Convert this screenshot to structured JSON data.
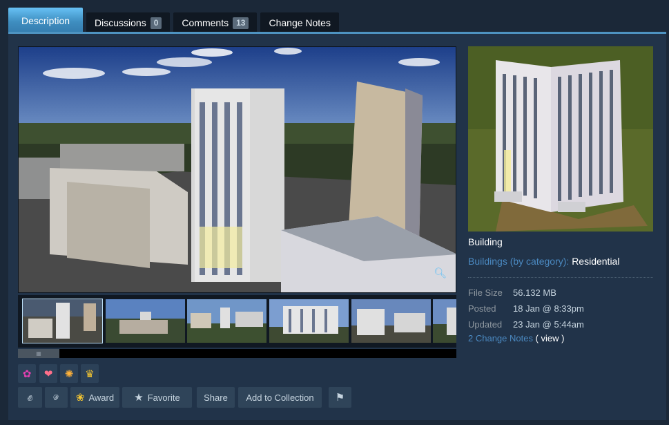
{
  "tabs": [
    {
      "label": "Description"
    },
    {
      "label": "Discussions",
      "count": "0"
    },
    {
      "label": "Comments",
      "count": "13"
    },
    {
      "label": "Change Notes"
    }
  ],
  "gallery": {
    "main_image": "city-residential-screenshot",
    "thumbnails_count_visible": 6,
    "zoom_icon": "zoom-icon"
  },
  "reactions": [
    {
      "icon": "flower-reaction-icon",
      "glyph": "✿",
      "color": "#e040b0"
    },
    {
      "icon": "hands-heart-reaction-icon",
      "glyph": "❤",
      "color": "#ff6f8a"
    },
    {
      "icon": "flame-reaction-icon",
      "glyph": "✺",
      "color": "#ffb23a"
    },
    {
      "icon": "trophy-reaction-icon",
      "glyph": "♛",
      "color": "#f3c532"
    }
  ],
  "actions": {
    "award": "Award",
    "favorite": "Favorite",
    "share": "Share",
    "add_to_collection": "Add to Collection"
  },
  "item": {
    "title": "Building",
    "category_key": "Buildings (by category):",
    "category_value": "Residential"
  },
  "stats": [
    {
      "key": "File Size",
      "value": "56.132 MB"
    },
    {
      "key": "Posted",
      "value": "18 Jan @ 8:33pm"
    },
    {
      "key": "Updated",
      "value": "23 Jan @ 5:44am"
    }
  ],
  "change_notes": {
    "link": "2 Change Notes",
    "view": "( view )"
  }
}
